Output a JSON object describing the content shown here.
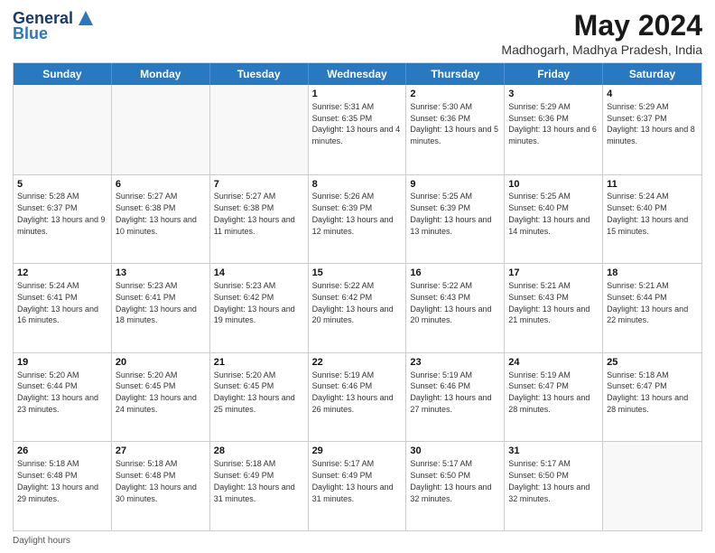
{
  "logo": {
    "line1": "General",
    "line2": "Blue"
  },
  "title": "May 2024",
  "subtitle": "Madhogarh, Madhya Pradesh, India",
  "header_days": [
    "Sunday",
    "Monday",
    "Tuesday",
    "Wednesday",
    "Thursday",
    "Friday",
    "Saturday"
  ],
  "weeks": [
    [
      {
        "day": "",
        "sunrise": "",
        "sunset": "",
        "daylight": ""
      },
      {
        "day": "",
        "sunrise": "",
        "sunset": "",
        "daylight": ""
      },
      {
        "day": "",
        "sunrise": "",
        "sunset": "",
        "daylight": ""
      },
      {
        "day": "1",
        "sunrise": "Sunrise: 5:31 AM",
        "sunset": "Sunset: 6:35 PM",
        "daylight": "Daylight: 13 hours and 4 minutes."
      },
      {
        "day": "2",
        "sunrise": "Sunrise: 5:30 AM",
        "sunset": "Sunset: 6:36 PM",
        "daylight": "Daylight: 13 hours and 5 minutes."
      },
      {
        "day": "3",
        "sunrise": "Sunrise: 5:29 AM",
        "sunset": "Sunset: 6:36 PM",
        "daylight": "Daylight: 13 hours and 6 minutes."
      },
      {
        "day": "4",
        "sunrise": "Sunrise: 5:29 AM",
        "sunset": "Sunset: 6:37 PM",
        "daylight": "Daylight: 13 hours and 8 minutes."
      }
    ],
    [
      {
        "day": "5",
        "sunrise": "Sunrise: 5:28 AM",
        "sunset": "Sunset: 6:37 PM",
        "daylight": "Daylight: 13 hours and 9 minutes."
      },
      {
        "day": "6",
        "sunrise": "Sunrise: 5:27 AM",
        "sunset": "Sunset: 6:38 PM",
        "daylight": "Daylight: 13 hours and 10 minutes."
      },
      {
        "day": "7",
        "sunrise": "Sunrise: 5:27 AM",
        "sunset": "Sunset: 6:38 PM",
        "daylight": "Daylight: 13 hours and 11 minutes."
      },
      {
        "day": "8",
        "sunrise": "Sunrise: 5:26 AM",
        "sunset": "Sunset: 6:39 PM",
        "daylight": "Daylight: 13 hours and 12 minutes."
      },
      {
        "day": "9",
        "sunrise": "Sunrise: 5:25 AM",
        "sunset": "Sunset: 6:39 PM",
        "daylight": "Daylight: 13 hours and 13 minutes."
      },
      {
        "day": "10",
        "sunrise": "Sunrise: 5:25 AM",
        "sunset": "Sunset: 6:40 PM",
        "daylight": "Daylight: 13 hours and 14 minutes."
      },
      {
        "day": "11",
        "sunrise": "Sunrise: 5:24 AM",
        "sunset": "Sunset: 6:40 PM",
        "daylight": "Daylight: 13 hours and 15 minutes."
      }
    ],
    [
      {
        "day": "12",
        "sunrise": "Sunrise: 5:24 AM",
        "sunset": "Sunset: 6:41 PM",
        "daylight": "Daylight: 13 hours and 16 minutes."
      },
      {
        "day": "13",
        "sunrise": "Sunrise: 5:23 AM",
        "sunset": "Sunset: 6:41 PM",
        "daylight": "Daylight: 13 hours and 18 minutes."
      },
      {
        "day": "14",
        "sunrise": "Sunrise: 5:23 AM",
        "sunset": "Sunset: 6:42 PM",
        "daylight": "Daylight: 13 hours and 19 minutes."
      },
      {
        "day": "15",
        "sunrise": "Sunrise: 5:22 AM",
        "sunset": "Sunset: 6:42 PM",
        "daylight": "Daylight: 13 hours and 20 minutes."
      },
      {
        "day": "16",
        "sunrise": "Sunrise: 5:22 AM",
        "sunset": "Sunset: 6:43 PM",
        "daylight": "Daylight: 13 hours and 20 minutes."
      },
      {
        "day": "17",
        "sunrise": "Sunrise: 5:21 AM",
        "sunset": "Sunset: 6:43 PM",
        "daylight": "Daylight: 13 hours and 21 minutes."
      },
      {
        "day": "18",
        "sunrise": "Sunrise: 5:21 AM",
        "sunset": "Sunset: 6:44 PM",
        "daylight": "Daylight: 13 hours and 22 minutes."
      }
    ],
    [
      {
        "day": "19",
        "sunrise": "Sunrise: 5:20 AM",
        "sunset": "Sunset: 6:44 PM",
        "daylight": "Daylight: 13 hours and 23 minutes."
      },
      {
        "day": "20",
        "sunrise": "Sunrise: 5:20 AM",
        "sunset": "Sunset: 6:45 PM",
        "daylight": "Daylight: 13 hours and 24 minutes."
      },
      {
        "day": "21",
        "sunrise": "Sunrise: 5:20 AM",
        "sunset": "Sunset: 6:45 PM",
        "daylight": "Daylight: 13 hours and 25 minutes."
      },
      {
        "day": "22",
        "sunrise": "Sunrise: 5:19 AM",
        "sunset": "Sunset: 6:46 PM",
        "daylight": "Daylight: 13 hours and 26 minutes."
      },
      {
        "day": "23",
        "sunrise": "Sunrise: 5:19 AM",
        "sunset": "Sunset: 6:46 PM",
        "daylight": "Daylight: 13 hours and 27 minutes."
      },
      {
        "day": "24",
        "sunrise": "Sunrise: 5:19 AM",
        "sunset": "Sunset: 6:47 PM",
        "daylight": "Daylight: 13 hours and 28 minutes."
      },
      {
        "day": "25",
        "sunrise": "Sunrise: 5:18 AM",
        "sunset": "Sunset: 6:47 PM",
        "daylight": "Daylight: 13 hours and 28 minutes."
      }
    ],
    [
      {
        "day": "26",
        "sunrise": "Sunrise: 5:18 AM",
        "sunset": "Sunset: 6:48 PM",
        "daylight": "Daylight: 13 hours and 29 minutes."
      },
      {
        "day": "27",
        "sunrise": "Sunrise: 5:18 AM",
        "sunset": "Sunset: 6:48 PM",
        "daylight": "Daylight: 13 hours and 30 minutes."
      },
      {
        "day": "28",
        "sunrise": "Sunrise: 5:18 AM",
        "sunset": "Sunset: 6:49 PM",
        "daylight": "Daylight: 13 hours and 31 minutes."
      },
      {
        "day": "29",
        "sunrise": "Sunrise: 5:17 AM",
        "sunset": "Sunset: 6:49 PM",
        "daylight": "Daylight: 13 hours and 31 minutes."
      },
      {
        "day": "30",
        "sunrise": "Sunrise: 5:17 AM",
        "sunset": "Sunset: 6:50 PM",
        "daylight": "Daylight: 13 hours and 32 minutes."
      },
      {
        "day": "31",
        "sunrise": "Sunrise: 5:17 AM",
        "sunset": "Sunset: 6:50 PM",
        "daylight": "Daylight: 13 hours and 32 minutes."
      },
      {
        "day": "",
        "sunrise": "",
        "sunset": "",
        "daylight": ""
      }
    ]
  ],
  "footer": "Daylight hours"
}
